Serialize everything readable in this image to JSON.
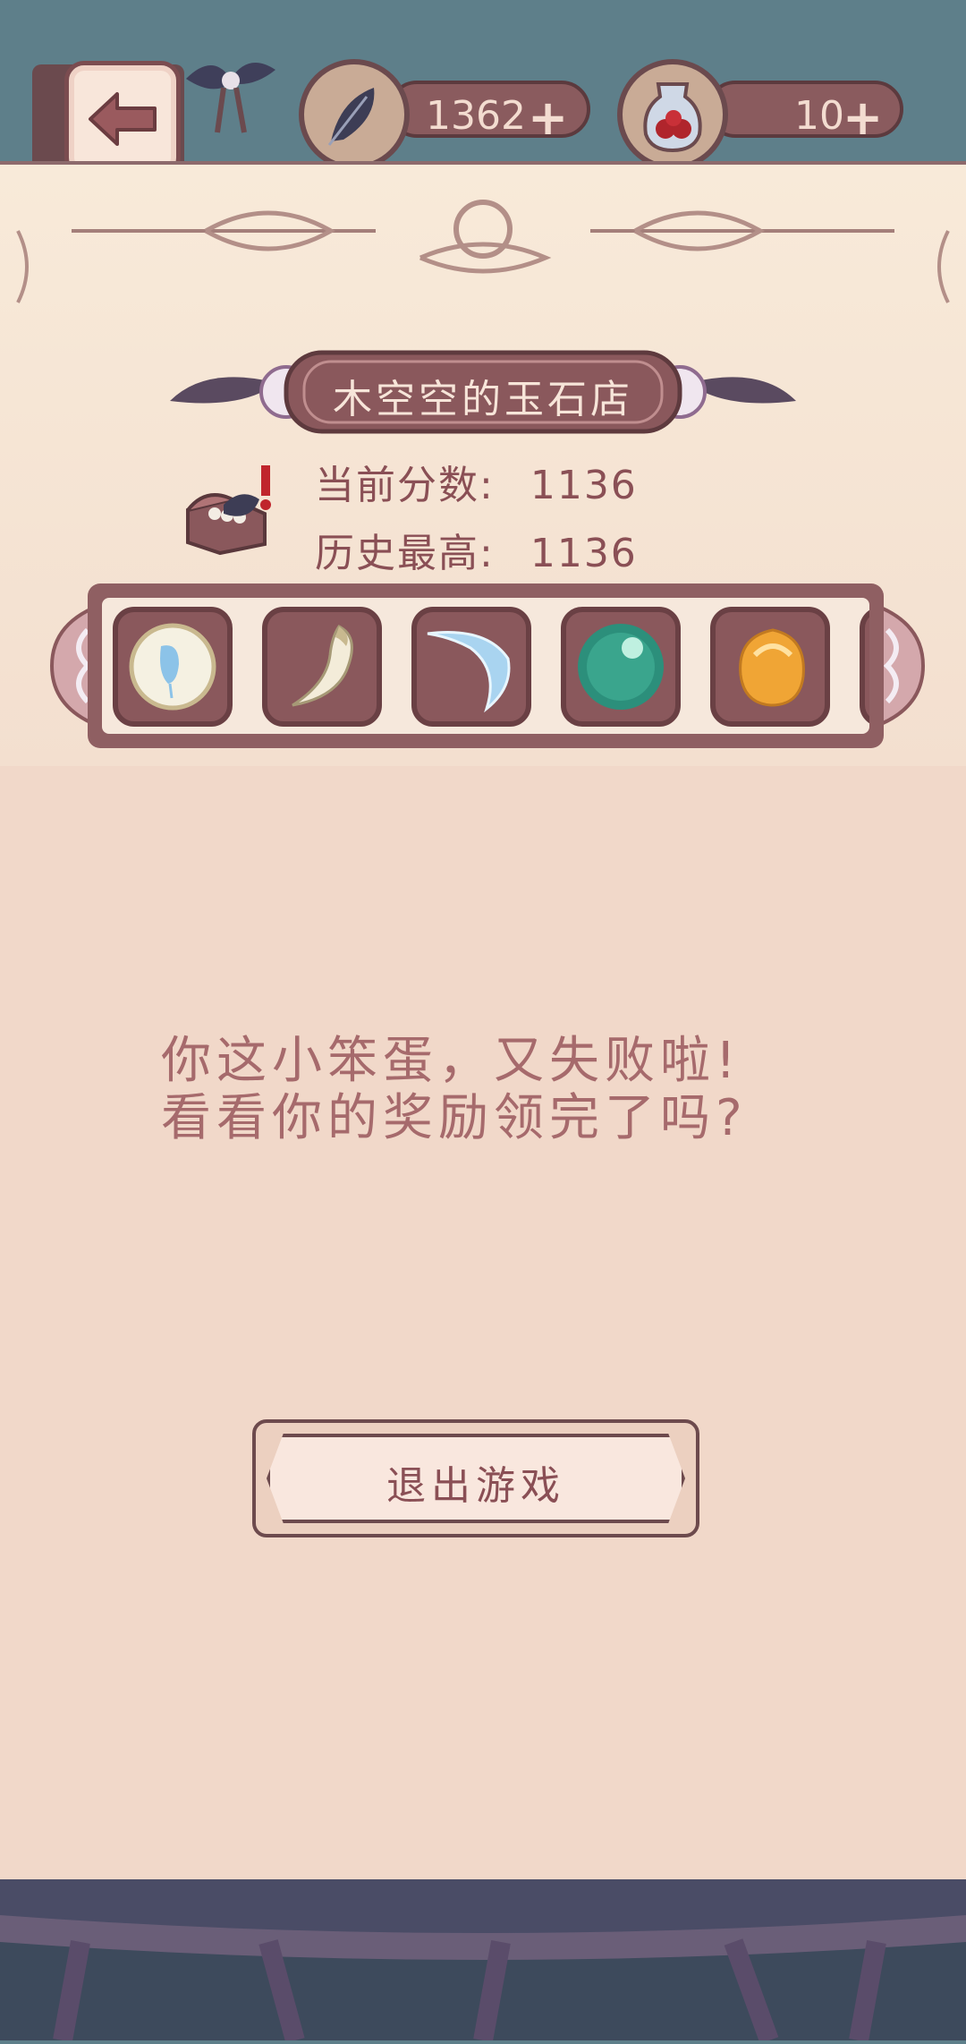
{
  "resources": {
    "feathers": {
      "icon": "feather-icon",
      "value": "1362",
      "add_label": "+"
    },
    "potions": {
      "icon": "jar-icon",
      "value": "10",
      "add_label": "+"
    }
  },
  "shop": {
    "title": "木空空的玉石店",
    "current_score_label": "当前分数:",
    "current_score_value": "1136",
    "best_score_label": "历史最高:",
    "best_score_value": "1136",
    "items": [
      {
        "icon": "blue-stone-plate-icon"
      },
      {
        "icon": "fang-icon"
      },
      {
        "icon": "ice-shard-icon"
      },
      {
        "icon": "jade-orb-icon"
      },
      {
        "icon": "amber-stone-icon"
      }
    ]
  },
  "message": {
    "line1": "你这小笨蛋，又失败啦!",
    "line2": "看看你的奖励领完了吗?"
  },
  "exit_button": {
    "label": "退出游戏"
  },
  "colors": {
    "panel": "#f1d8c9",
    "accent": "#8a585c",
    "text": "#8a4f55",
    "sky": "#5e7f8a"
  }
}
